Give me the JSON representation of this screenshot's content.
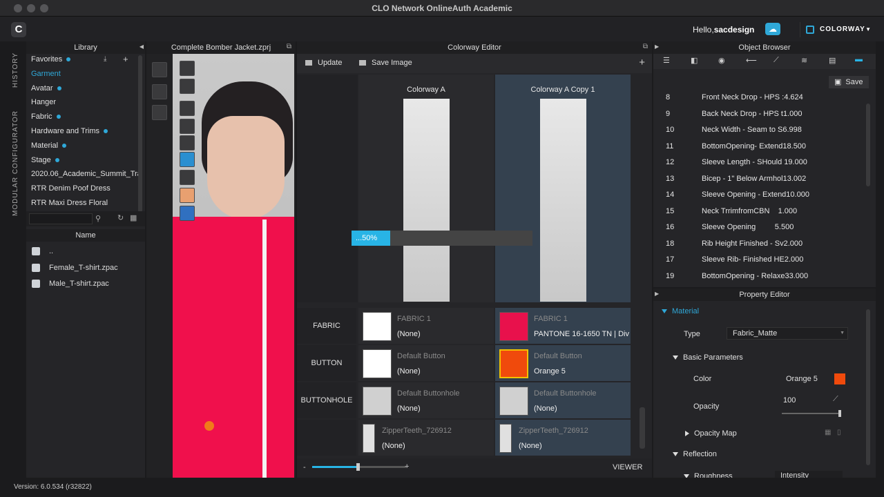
{
  "window": {
    "title": "CLO Network OnlineAuth Academic"
  },
  "header": {
    "logo": "C",
    "hello_prefix": "Hello,",
    "username": "sacdesign",
    "colorway_label": "COLORWAY"
  },
  "side_tabs": [
    "HISTORY",
    "MODULAR CONFIGURATOR"
  ],
  "library": {
    "title": "Library",
    "items": [
      {
        "label": "Favorites",
        "dot": true
      },
      {
        "label": "Garment",
        "dot": false
      },
      {
        "label": "Avatar",
        "dot": true
      },
      {
        "label": "Hanger",
        "dot": false
      },
      {
        "label": "Fabric",
        "dot": true
      },
      {
        "label": "Hardware and Trims",
        "dot": true
      },
      {
        "label": "Material",
        "dot": true
      },
      {
        "label": "Stage",
        "dot": true
      },
      {
        "label": "2020.06_Academic_Summit_Tra",
        "dot": false
      },
      {
        "label": "RTR Denim Poof Dress",
        "dot": false
      },
      {
        "label": "RTR Maxi Dress Floral",
        "dot": false
      }
    ],
    "name_header": "Name",
    "files": [
      "..",
      "Female_T-shirt.zpac",
      "Male_T-shirt.zpac"
    ]
  },
  "viewport": {
    "title": "Complete Bomber Jacket.zprj"
  },
  "colorway_editor": {
    "title": "Colorway Editor",
    "update_label": "Update",
    "save_image_label": "Save Image",
    "columns": [
      "Colorway A",
      "Colorway A Copy 1"
    ],
    "progress": {
      "label": "...50%",
      "value": 50
    },
    "rows": [
      {
        "label": "FABRIC",
        "a": {
          "name": "FABRIC 1",
          "value": "(None)",
          "color": "#ffffff"
        },
        "b": {
          "name": "FABRIC 1",
          "value": "PANTONE 16-1650 TN | Div",
          "color": "#e8114c"
        }
      },
      {
        "label": "BUTTON",
        "a": {
          "name": "Default Button",
          "value": "(None)",
          "color": "#ffffff"
        },
        "b": {
          "name": "Default Button",
          "value": "Orange 5",
          "color": "#f04a0c"
        }
      },
      {
        "label": "BUTTONHOLE",
        "a": {
          "name": "Default Buttonhole",
          "value": "(None)",
          "color": "#d0d0d0"
        },
        "b": {
          "name": "Default Buttonhole",
          "value": "(None)",
          "color": "#d0d0d0"
        }
      },
      {
        "label": "",
        "a": {
          "name": "ZipperTeeth_726912",
          "value": "(None)",
          "color": "#e0e0e0"
        },
        "b": {
          "name": "ZipperTeeth_726912",
          "value": "(None)",
          "color": "#e0e0e0"
        }
      }
    ],
    "zoom_minus": "-",
    "zoom_plus": "+",
    "viewer_label": "VIEWER"
  },
  "object_browser": {
    "title": "Object Browser",
    "save_label": "Save",
    "rows": [
      {
        "n": "8",
        "t": "Front Neck Drop - HPS :4.624"
      },
      {
        "n": "9",
        "t": "Back Neck Drop - HPS t1.000"
      },
      {
        "n": "10",
        "t": "Neck Width - Seam to S6.998"
      },
      {
        "n": "11",
        "t": "BottomOpening- Extend18.500"
      },
      {
        "n": "12",
        "t": "Sleeve Length - SHould 19.000"
      },
      {
        "n": "13",
        "t": "Bicep - 1\" Below Armhol13.002"
      },
      {
        "n": "14",
        "t": "Sleeve Opening - Extend10.000"
      },
      {
        "n": "15",
        "t": "Neck TrrimfromCBN    1.000"
      },
      {
        "n": "16",
        "t": "Sleeve Opening         5.500"
      },
      {
        "n": "18",
        "t": "Rib Height Finished - Sv2.000"
      },
      {
        "n": "17",
        "t": "Sleeve Rib- Finished HE2.000"
      },
      {
        "n": "19",
        "t": "BottomOpening - Relaxe33.000"
      }
    ]
  },
  "property_editor": {
    "title": "Property Editor",
    "section": "Material",
    "type_label": "Type",
    "type_value": "Fabric_Matte",
    "basic_params": "Basic Parameters",
    "color_label": "Color",
    "color_value": "Orange 5",
    "color_hex": "#f04a0c",
    "opacity_label": "Opacity",
    "opacity_value": "100",
    "opacity_map": "Opacity Map",
    "reflection": "Reflection",
    "roughness": "Roughness",
    "intensity": "Intensity"
  },
  "status": {
    "version": "Version: 6.0.534 (r32822)"
  }
}
